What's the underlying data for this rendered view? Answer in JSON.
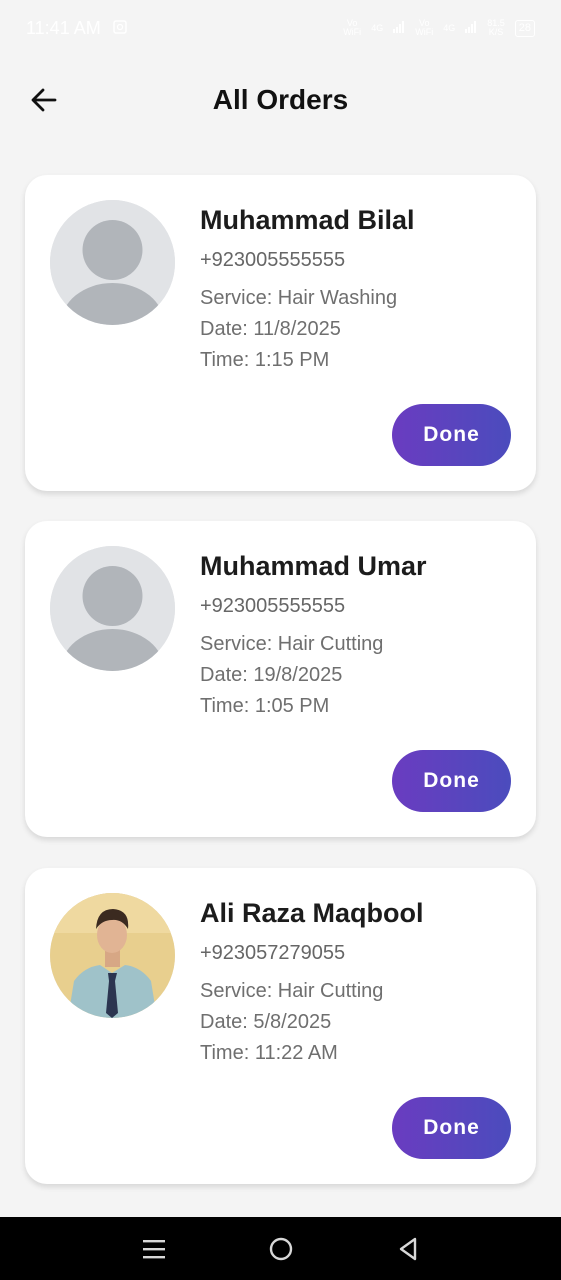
{
  "status_bar": {
    "time": "11:41 AM",
    "sim1_top": "Vo",
    "sim1_bottom": "WiFi",
    "net1": "4G",
    "sim2_top": "Vo",
    "sim2_bottom": "WiFi",
    "net2": "4G",
    "speed_top": "81.5",
    "speed_bottom": "K/S",
    "battery": "28"
  },
  "header": {
    "title": "All Orders"
  },
  "orders": [
    {
      "name": "Muhammad Bilal",
      "phone": "+923005555555",
      "service": "Service: Hair Washing",
      "date": "Date: 11/8/2025",
      "time": "Time: 1:15 PM",
      "button": "Done",
      "avatar": "default-avatar"
    },
    {
      "name": "Muhammad Umar",
      "phone": "+923005555555",
      "service": "Service: Hair Cutting",
      "date": "Date: 19/8/2025",
      "time": "Time: 1:05 PM",
      "button": "Done",
      "avatar": "default-avatar"
    },
    {
      "name": "Ali Raza Maqbool",
      "phone": "+923057279055",
      "service": "Service: Hair Cutting",
      "date": "Date: 5/8/2025",
      "time": "Time: 11:22 AM",
      "button": "Done",
      "avatar": "photo"
    }
  ],
  "nav_bar": {
    "icons": [
      "menu-icon",
      "home-circle-icon",
      "back-triangle-icon"
    ]
  },
  "colors": {
    "accent_start": "#6a3cc0",
    "accent_end": "#4b4cbd",
    "background": "#f4f4f4",
    "card": "#ffffff"
  }
}
